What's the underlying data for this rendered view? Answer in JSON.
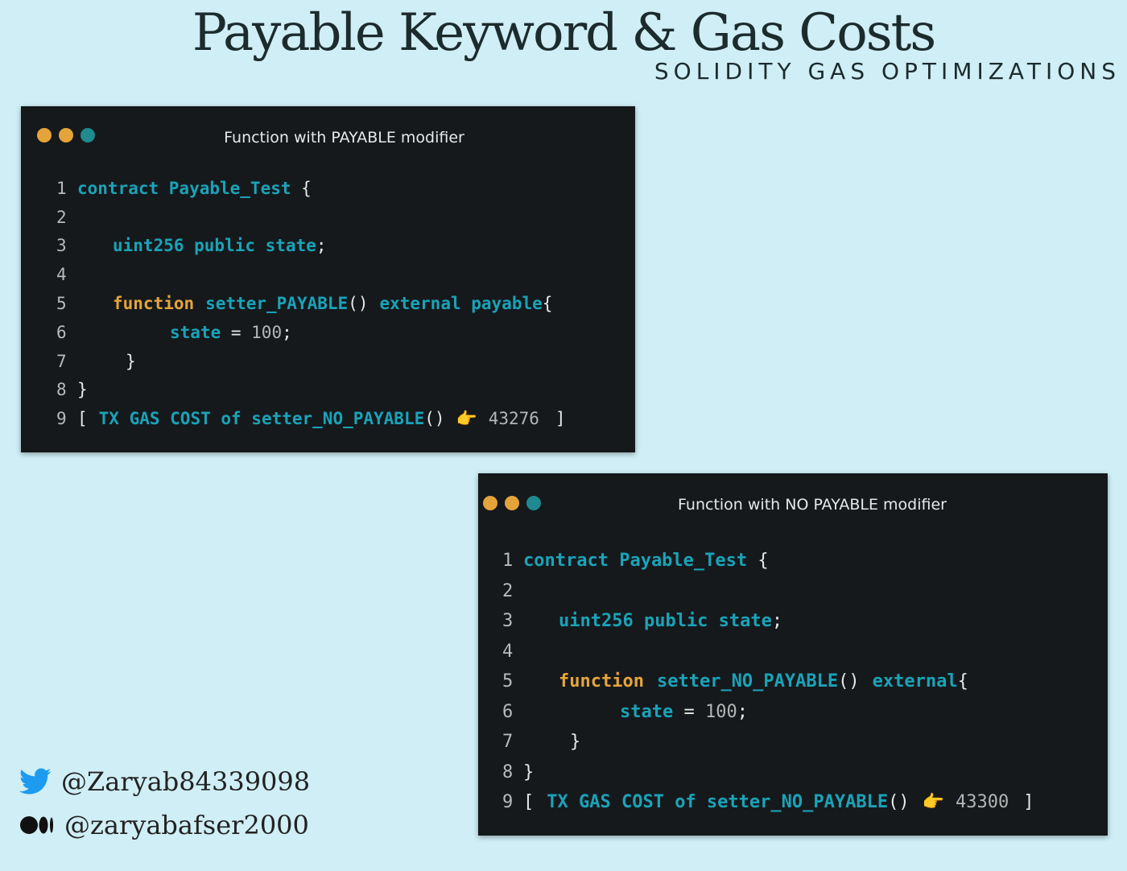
{
  "header": {
    "title": "Payable Keyword & Gas Costs",
    "subtitle": "SOLIDITY GAS OPTIMIZATIONS"
  },
  "colors": {
    "background": "#cfeef5",
    "window": "#15191c",
    "keyword": "#1aa3b8",
    "function_kw": "#e5a43a",
    "dot_orange": "#e5a43a",
    "dot_teal": "#1f8a8f"
  },
  "window1": {
    "title": "Function with PAYABLE modifier",
    "line_numbers": [
      "1",
      "2",
      "3",
      "4",
      "5",
      "6",
      "7",
      "8",
      "9"
    ],
    "l1_kw": "contract Payable_Test",
    "l1_brace": " {",
    "l3_kw": "uint256 public state",
    "l3_semi": ";",
    "l5_fn": "function",
    "l5_name": "setter_PAYABLE",
    "l5_parens": "()",
    "l5_mods": "external payable",
    "l5_brace": "{",
    "l6_kw": "state",
    "l6_eq": " = ",
    "l6_val": "100",
    "l6_semi": ";",
    "l7_brace": "}",
    "l8_brace": "}",
    "l9_open": "[",
    "l9_label": "TX GAS COST of setter_NO_PAYABLE",
    "l9_parens": "()",
    "l9_icon": "👉",
    "l9_value": "43276",
    "l9_close": "]"
  },
  "window2": {
    "title": "Function with NO PAYABLE modifier",
    "line_numbers": [
      "1",
      "2",
      "3",
      "4",
      "5",
      "6",
      "7",
      "8",
      "9"
    ],
    "l1_kw": "contract Payable_Test",
    "l1_brace": " {",
    "l3_kw": "uint256 public state",
    "l3_semi": ";",
    "l5_fn": "function",
    "l5_name": "setter_NO_PAYABLE",
    "l5_parens": "()",
    "l5_mods": "external",
    "l5_brace": "{",
    "l6_kw": "state",
    "l6_eq": " = ",
    "l6_val": "100",
    "l6_semi": ";",
    "l7_brace": "}",
    "l8_brace": "}",
    "l9_open": "[",
    "l9_label": "TX GAS COST of setter_NO_PAYABLE",
    "l9_parens": "()",
    "l9_icon": "👉",
    "l9_value": "43300",
    "l9_close": "]"
  },
  "social": {
    "twitter_icon": "twitter-bird-icon",
    "twitter_handle": "@Zaryab84339098",
    "medium_icon": "medium-logo-icon",
    "medium_handle": "@zaryabafser2000"
  }
}
